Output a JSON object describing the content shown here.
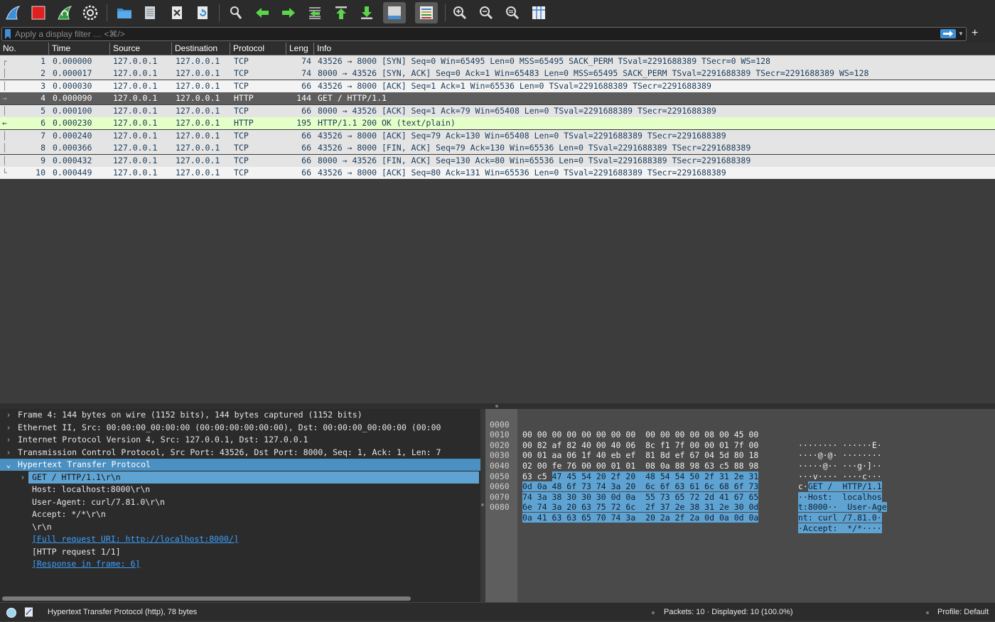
{
  "toolbar": {
    "icons": [
      "shark-fin-start-icon",
      "stop-capture-icon",
      "restart-capture-icon",
      "capture-options-icon",
      "open-file-icon",
      "save-file-icon",
      "close-file-icon",
      "reload-file-icon",
      "find-packet-icon",
      "go-back-icon",
      "go-forward-icon",
      "go-to-packet-icon",
      "go-first-icon",
      "go-last-icon",
      "autoscroll-icon",
      "colorize-icon",
      "zoom-in-icon",
      "zoom-out-icon",
      "zoom-normal-icon",
      "resize-columns-icon"
    ]
  },
  "filter": {
    "placeholder": "Apply a display filter … <⌘/>",
    "plus": "+"
  },
  "packet_list": {
    "columns": [
      "No.",
      "Time",
      "Source",
      "Destination",
      "Protocol",
      "Leng",
      "Info"
    ],
    "rows": [
      {
        "no": "1",
        "time": "0.000000",
        "src": "127.0.0.1",
        "dst": "127.0.0.1",
        "proto": "TCP",
        "len": "74",
        "info": "43526 → 8000 [SYN] Seq=0 Win=65495 Len=0 MSS=65495 SACK_PERM TSval=2291688389 TSecr=0 WS=128"
      },
      {
        "no": "2",
        "time": "0.000017",
        "src": "127.0.0.1",
        "dst": "127.0.0.1",
        "proto": "TCP",
        "len": "74",
        "info": "8000 → 43526 [SYN, ACK] Seq=0 Ack=1 Win=65483 Len=0 MSS=65495 SACK_PERM TSval=2291688389 TSecr=2291688389 WS=128"
      },
      {
        "no": "3",
        "time": "0.000030",
        "src": "127.0.0.1",
        "dst": "127.0.0.1",
        "proto": "TCP",
        "len": "66",
        "info": "43526 → 8000 [ACK] Seq=1 Ack=1 Win=65536 Len=0 TSval=2291688389 TSecr=2291688389"
      },
      {
        "no": "4",
        "time": "0.000090",
        "src": "127.0.0.1",
        "dst": "127.0.0.1",
        "proto": "HTTP",
        "len": "144",
        "info": "GET / HTTP/1.1"
      },
      {
        "no": "5",
        "time": "0.000100",
        "src": "127.0.0.1",
        "dst": "127.0.0.1",
        "proto": "TCP",
        "len": "66",
        "info": "8000 → 43526 [ACK] Seq=1 Ack=79 Win=65408 Len=0 TSval=2291688389 TSecr=2291688389"
      },
      {
        "no": "6",
        "time": "0.000230",
        "src": "127.0.0.1",
        "dst": "127.0.0.1",
        "proto": "HTTP",
        "len": "195",
        "info": "HTTP/1.1 200 OK  (text/plain)"
      },
      {
        "no": "7",
        "time": "0.000240",
        "src": "127.0.0.1",
        "dst": "127.0.0.1",
        "proto": "TCP",
        "len": "66",
        "info": "43526 → 8000 [ACK] Seq=79 Ack=130 Win=65408 Len=0 TSval=2291688389 TSecr=2291688389"
      },
      {
        "no": "8",
        "time": "0.000366",
        "src": "127.0.0.1",
        "dst": "127.0.0.1",
        "proto": "TCP",
        "len": "66",
        "info": "43526 → 8000 [FIN, ACK] Seq=79 Ack=130 Win=65536 Len=0 TSval=2291688389 TSecr=2291688389"
      },
      {
        "no": "9",
        "time": "0.000432",
        "src": "127.0.0.1",
        "dst": "127.0.0.1",
        "proto": "TCP",
        "len": "66",
        "info": "8000 → 43526 [FIN, ACK] Seq=130 Ack=80 Win=65536 Len=0 TSval=2291688389 TSecr=2291688389"
      },
      {
        "no": "10",
        "time": "0.000449",
        "src": "127.0.0.1",
        "dst": "127.0.0.1",
        "proto": "TCP",
        "len": "66",
        "info": "43526 → 8000 [ACK] Seq=80 Ack=131 Win=65536 Len=0 TSval=2291688389 TSecr=2291688389"
      }
    ]
  },
  "details": {
    "frame": "Frame 4: 144 bytes on wire (1152 bits), 144 bytes captured (1152 bits)",
    "ethernet": "Ethernet II, Src: 00:00:00_00:00:00 (00:00:00:00:00:00), Dst: 00:00:00_00:00:00 (00:00",
    "ip": "Internet Protocol Version 4, Src: 127.0.0.1, Dst: 127.0.0.1",
    "tcp": "Transmission Control Protocol, Src Port: 43526, Dst Port: 8000, Seq: 1, Ack: 1, Len: 7",
    "http": "Hypertext Transfer Protocol",
    "get": "GET / HTTP/1.1\\r\\n",
    "host": "Host: localhost:8000\\r\\n",
    "ua": "User-Agent: curl/7.81.0\\r\\n",
    "accept": "Accept: */*\\r\\n",
    "crlf": "\\r\\n",
    "full_uri": "[Full request URI: http://localhost:8000/]",
    "req_num": "[HTTP request 1/1]",
    "response_in": "[Response in frame: 6]"
  },
  "bytes": {
    "rows": [
      {
        "off": "0000",
        "hex1": "00 00 00 00 00 00 00 00  00 00 00 00 08 00 45 00",
        "hex2": "",
        "ascii1": "········ ······E·",
        "ascii2": ""
      },
      {
        "off": "0010",
        "hex1": "00 82 af 82 40 00 40 06  8c f1 7f 00 00 01 7f 00",
        "hex2": "",
        "ascii1": "····@·@· ········",
        "ascii2": ""
      },
      {
        "off": "0020",
        "hex1": "00 01 aa 06 1f 40 eb ef  81 8d ef 67 04 5d 80 18",
        "hex2": "",
        "ascii1": "·····@·· ···g·]··",
        "ascii2": ""
      },
      {
        "off": "0030",
        "hex1": "02 00 fe 76 00 00 01 01  08 0a 88 98 63 c5 88 98",
        "hex2": "",
        "ascii1": "···v···· ····c···",
        "ascii2": ""
      },
      {
        "off": "0040",
        "hex1": "63 c5 ",
        "hex2": "47 45 54 20 2f 20  48 54 54 50 2f 31 2e 31",
        "ascii1": "c·",
        "ascii2": "GET /  HTTP/1.1"
      },
      {
        "off": "0050",
        "hex1": "",
        "hex2": "0d 0a 48 6f 73 74 3a 20  6c 6f 63 61 6c 68 6f 73",
        "ascii1": "",
        "ascii2": "··Host:  localhos"
      },
      {
        "off": "0060",
        "hex1": "",
        "hex2": "74 3a 38 30 30 30 0d 0a  55 73 65 72 2d 41 67 65",
        "ascii1": "",
        "ascii2": "t:8000··  User-Age"
      },
      {
        "off": "0070",
        "hex1": "",
        "hex2": "6e 74 3a 20 63 75 72 6c  2f 37 2e 38 31 2e 30 0d",
        "ascii1": "",
        "ascii2": "nt: curl /7.81.0·"
      },
      {
        "off": "0080",
        "hex1": "",
        "hex2": "0a 41 63 63 65 70 74 3a  20 2a 2f 2a 0d 0a 0d 0a",
        "ascii1": "",
        "ascii2": "·Accept:  */*····"
      }
    ]
  },
  "status": {
    "protocol": "Hypertext Transfer Protocol (http), 78 bytes",
    "packets": "Packets: 10 · Displayed: 10 (100.0%)",
    "profile": "Profile: Default"
  },
  "colors": {
    "tcp_row": "#e4e4e4",
    "http_row": "#e4ffc7",
    "selected_row": "#5d5d5d",
    "highlight": "#5fa3d3"
  }
}
